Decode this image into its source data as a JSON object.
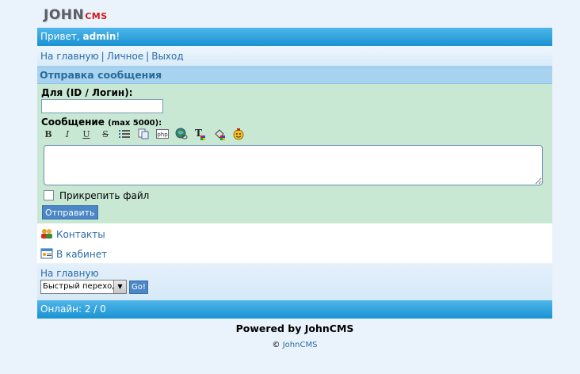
{
  "logo": {
    "john": "JOHN",
    "cms": "CMS"
  },
  "header": {
    "greeting": "Привет, ",
    "username": "admin",
    "suffix": "!"
  },
  "nav": {
    "items": [
      {
        "label": "На главную"
      },
      {
        "label": "Личное"
      },
      {
        "label": "Выход"
      }
    ],
    "separator": "|"
  },
  "section_title": "Отправка сообщения",
  "form": {
    "to_label": "Для (ID / Логин):",
    "to_value": "",
    "message_label": "Сообщение",
    "message_hint": "(max 5000):",
    "toolbar": [
      {
        "name": "bold-icon",
        "glyph": "B"
      },
      {
        "name": "italic-icon",
        "glyph": "I"
      },
      {
        "name": "underline-icon",
        "glyph": "U"
      },
      {
        "name": "strikethrough-icon",
        "glyph": "S"
      },
      {
        "name": "list-icon",
        "glyph": "☰"
      },
      {
        "name": "quote-icon",
        "glyph": "❐"
      },
      {
        "name": "php-code-icon",
        "glyph": "php"
      },
      {
        "name": "link-icon",
        "glyph": "🌐"
      },
      {
        "name": "text-color-icon",
        "glyph": "T"
      },
      {
        "name": "background-color-icon",
        "glyph": "◈"
      },
      {
        "name": "smiley-icon",
        "glyph": "☺"
      }
    ],
    "message_value": "",
    "attach_label": "Прикрепить файл",
    "attach_checked": false,
    "submit_label": "Отправить"
  },
  "links": [
    {
      "label": "Контакты",
      "icon": "contacts-icon"
    },
    {
      "label": "В кабинет",
      "icon": "cabinet-icon"
    }
  ],
  "footer_nav": {
    "home": "На главную",
    "select_value": "Быстрый переход",
    "go_label": "Go!"
  },
  "online": "Онлайн: 2 / 0",
  "powered": "Powered by JohnCMS",
  "copyright": {
    "symbol": "©",
    "link": "JohnCMS"
  },
  "colors": {
    "header_blue": "#1a92d2",
    "link": "#2a6aa8",
    "form_bg": "#c8e8d4",
    "section_bg": "#a8d3f0",
    "logo_red": "#d01818"
  }
}
